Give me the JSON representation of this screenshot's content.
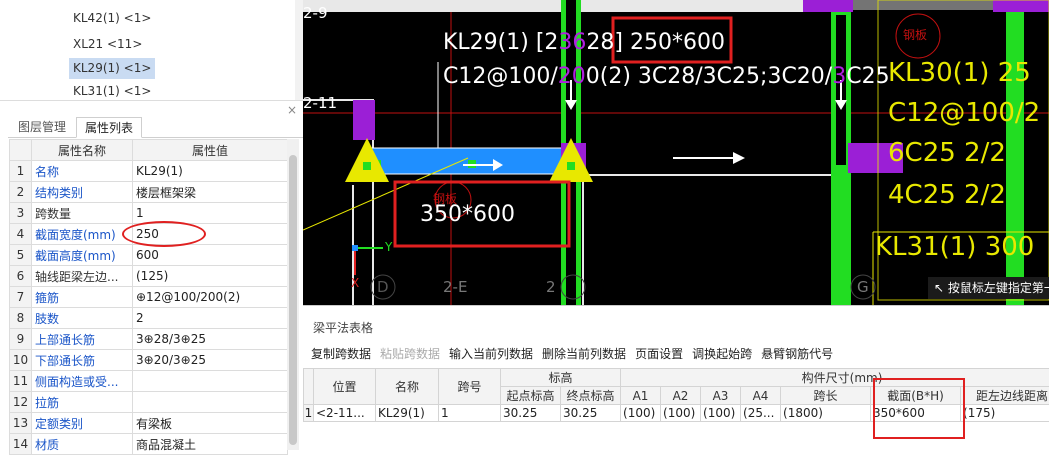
{
  "tree": {
    "items": [
      {
        "label": "KL42(1)  <1>",
        "selected": false
      },
      {
        "label": "XL21  <11>",
        "selected": false
      },
      {
        "label": "KL29(1)  <1>",
        "selected": true
      },
      {
        "label": "KL31(1)  <1>",
        "selected": false
      }
    ]
  },
  "panel": {
    "close_icon": "×",
    "tabs": [
      "图层管理",
      "属性列表"
    ],
    "active_tab": 1,
    "header": {
      "name": "属性名称",
      "value": "属性值"
    },
    "rows": [
      {
        "idx": "1",
        "name": "名称",
        "value": "KL29(1)",
        "blue": true
      },
      {
        "idx": "2",
        "name": "结构类别",
        "value": "楼层框架梁",
        "blue": true
      },
      {
        "idx": "3",
        "name": "跨数量",
        "value": "1",
        "blue": false
      },
      {
        "idx": "4",
        "name": "截面宽度(mm)",
        "value": "250",
        "blue": true
      },
      {
        "idx": "5",
        "name": "截面高度(mm)",
        "value": "600",
        "blue": true
      },
      {
        "idx": "6",
        "name": "轴线距梁左边...",
        "value": "(125)",
        "blue": false
      },
      {
        "idx": "7",
        "name": "箍筋",
        "value": "⊕12@100/200(2)",
        "blue": true
      },
      {
        "idx": "8",
        "name": "肢数",
        "value": "2",
        "blue": true
      },
      {
        "idx": "9",
        "name": "上部通长筋",
        "value": "3⊕28/3⊕25",
        "blue": true
      },
      {
        "idx": "10",
        "name": "下部通长筋",
        "value": "3⊕20/3⊕25",
        "blue": true
      },
      {
        "idx": "11",
        "name": "侧面构造或受...",
        "value": "",
        "blue": true
      },
      {
        "idx": "12",
        "name": "拉筋",
        "value": "",
        "blue": true
      },
      {
        "idx": "13",
        "name": "定额类别",
        "value": "有梁板",
        "blue": true
      },
      {
        "idx": "14",
        "name": "材质",
        "value": "商品混凝土",
        "blue": true
      }
    ]
  },
  "cad": {
    "axis_labels": {
      "top": "2-9",
      "mid": "2-11",
      "bottom": [
        "D",
        "2-E",
        "2",
        "G"
      ],
      "x_axis": "X",
      "y_axis": "Y"
    },
    "beam_label_line1_parts": [
      "KL29(1) [2",
      "36",
      "28] ",
      "250*600"
    ],
    "beam_label_line2_parts": [
      "C12@100/",
      "20",
      "0(2) 3C28/3C25;3C20/",
      "3",
      "C25"
    ],
    "section_label": "350*600",
    "stamp_text": "钢板",
    "right_texts": [
      "KL30(1)  25",
      "C12@100/2",
      "6C25 2/2",
      "4C25 2/2",
      "KL31(1)  300"
    ],
    "hint": "按鼠标左键指定第一"
  },
  "bottom": {
    "title": "梁平法表格",
    "toolbar": [
      {
        "label": "复制跨数据",
        "disabled": false
      },
      {
        "label": "粘贴跨数据",
        "disabled": true
      },
      {
        "label": "输入当前列数据",
        "disabled": false
      },
      {
        "label": "删除当前列数据",
        "disabled": false
      },
      {
        "label": "页面设置",
        "disabled": false
      },
      {
        "label": "调换起始跨",
        "disabled": false
      },
      {
        "label": "悬臂钢筋代号",
        "disabled": false
      }
    ],
    "header": {
      "position": "位置",
      "name": "名称",
      "span": "跨号",
      "elevation": "标高",
      "elev_start": "起点标高",
      "elev_end": "终点标高",
      "size_group": "构件尺寸(mm)",
      "a1": "A1",
      "a2": "A2",
      "a3": "A3",
      "a4": "A4",
      "span_len": "跨长",
      "section": "截面(B*H)",
      "offset": "距左边线距离"
    },
    "row": {
      "idx": "1",
      "position": "<2-11...",
      "name": "KL29(1)",
      "span": "1",
      "elev_start": "30.25",
      "elev_end": "30.25",
      "a1": "(100)",
      "a2": "(100)",
      "a3": "(100)",
      "a4": "(25...",
      "span_len": "(1800)",
      "section": "350*600",
      "offset": "(175)"
    }
  },
  "colors": {
    "highlight_red": "#e02020",
    "beam_green": "#22dd22",
    "beam_blue": "#1f8fff",
    "column_purple": "#9b1fd6",
    "cad_yellow": "#e8e800"
  }
}
